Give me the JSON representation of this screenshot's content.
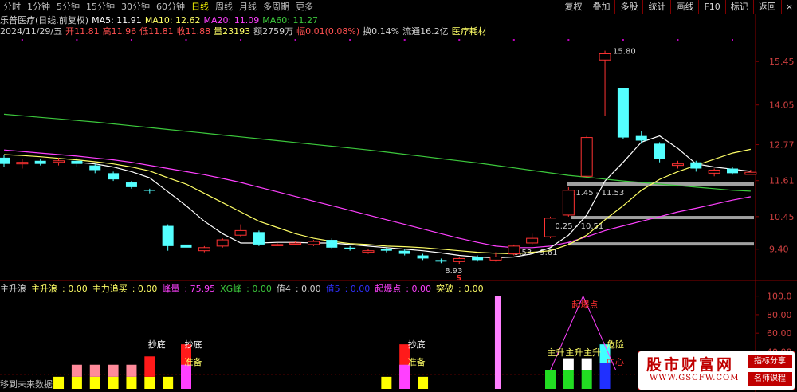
{
  "toolbar": {
    "periods": [
      "分时",
      "1分钟",
      "5分钟",
      "15分钟",
      "30分钟",
      "60分钟",
      "日线",
      "周线",
      "月线",
      "多周期",
      "更多"
    ],
    "active_period": "日线",
    "tools": [
      "复权",
      "叠加",
      "多股",
      "统计",
      "画线",
      "F10",
      "标记",
      "返回"
    ],
    "close_glyph": "×"
  },
  "title": {
    "name": "乐普医疗(日线,前复权)",
    "ma5": "MA5: 11.91",
    "ma10": "MA10: 12.62",
    "ma20": "MA20: 11.09",
    "ma60": "MA60: 11.27"
  },
  "info": {
    "date": "2024/11/29/五",
    "open": "开11.81",
    "high": "高11.96",
    "low": "低11.81",
    "close": "收11.88",
    "volume": "量23193",
    "amount": "额2759万",
    "change": "幅0.01(0.08%)",
    "turnover": "换0.14%",
    "float": "流通16.2亿",
    "sector": "医疗耗材"
  },
  "colors": {
    "up": "#ff3232",
    "down": "#54ffff",
    "ma5": "#ffffff",
    "ma10": "#ffff66",
    "ma20": "#ff40ff",
    "ma60": "#3cc83c",
    "axis": "#880000",
    "hbar": "#a0a0a0"
  },
  "price_axis": {
    "labels": [
      "15.45",
      "14.05",
      "12.77",
      "11.61",
      "10.45",
      "9.40"
    ],
    "values": [
      15.45,
      14.05,
      12.77,
      11.61,
      10.45,
      9.4
    ]
  },
  "indicator_axis": {
    "labels": [
      "100.0",
      "80.00",
      "60.00",
      "40.00",
      "20.00"
    ],
    "values": [
      100,
      80,
      60,
      40,
      20
    ]
  },
  "chart_data": {
    "type": "candlestick",
    "price_range": [
      8.7,
      16.2
    ],
    "candles": [
      {
        "o": 12.35,
        "c": 12.15,
        "h": 12.45,
        "l": 12.05
      },
      {
        "o": 12.15,
        "c": 12.2,
        "h": 12.3,
        "l": 12.0
      },
      {
        "o": 12.25,
        "c": 12.15,
        "h": 12.3,
        "l": 12.1
      },
      {
        "o": 12.2,
        "c": 12.25,
        "h": 12.35,
        "l": 12.1
      },
      {
        "o": 12.25,
        "c": 12.15,
        "h": 12.35,
        "l": 12.05
      },
      {
        "o": 12.1,
        "c": 11.95,
        "h": 12.15,
        "l": 11.85
      },
      {
        "o": 11.85,
        "c": 11.65,
        "h": 11.9,
        "l": 11.6
      },
      {
        "o": 11.55,
        "c": 11.4,
        "h": 11.6,
        "l": 11.35
      },
      {
        "o": 11.32,
        "c": 11.3,
        "h": 11.35,
        "l": 11.2
      },
      {
        "o": 10.15,
        "c": 9.5,
        "h": 10.2,
        "l": 9.35
      },
      {
        "o": 9.55,
        "c": 9.45,
        "h": 9.6,
        "l": 9.35
      },
      {
        "o": 9.35,
        "c": 9.45,
        "h": 9.5,
        "l": 9.3
      },
      {
        "o": 9.5,
        "c": 9.7,
        "h": 9.75,
        "l": 9.45
      },
      {
        "o": 9.85,
        "c": 10.0,
        "h": 10.2,
        "l": 9.8
      },
      {
        "o": 9.95,
        "c": 9.55,
        "h": 10.0,
        "l": 9.5
      },
      {
        "o": 9.55,
        "c": 9.55,
        "h": 9.6,
        "l": 9.5
      },
      {
        "o": 9.6,
        "c": 9.6,
        "h": 9.65,
        "l": 9.55
      },
      {
        "o": 9.55,
        "c": 9.65,
        "h": 9.7,
        "l": 9.5
      },
      {
        "o": 9.7,
        "c": 9.45,
        "h": 9.75,
        "l": 9.4
      },
      {
        "o": 9.45,
        "c": 9.4,
        "h": 9.5,
        "l": 9.35
      },
      {
        "o": 9.3,
        "c": 9.35,
        "h": 9.4,
        "l": 9.25
      },
      {
        "o": 9.4,
        "c": 9.35,
        "h": 9.45,
        "l": 9.3
      },
      {
        "o": 9.35,
        "c": 9.25,
        "h": 9.4,
        "l": 9.2
      },
      {
        "o": 9.2,
        "c": 9.1,
        "h": 9.25,
        "l": 9.05
      },
      {
        "o": 9.05,
        "c": 9.0,
        "h": 9.1,
        "l": 8.95
      },
      {
        "o": 9.0,
        "c": 9.1,
        "h": 9.15,
        "l": 8.93
      },
      {
        "o": 9.15,
        "c": 9.05,
        "h": 9.2,
        "l": 9.0
      },
      {
        "o": 9.05,
        "c": 9.15,
        "h": 9.3,
        "l": 9.0
      },
      {
        "o": 9.25,
        "c": 9.5,
        "h": 9.55,
        "l": 9.2
      },
      {
        "o": 9.6,
        "c": 9.75,
        "h": 9.9,
        "l": 9.55
      },
      {
        "o": 9.8,
        "c": 10.4,
        "h": 10.45,
        "l": 9.75
      },
      {
        "o": 10.5,
        "c": 11.3,
        "h": 11.4,
        "l": 10.45
      },
      {
        "o": 11.75,
        "c": 13.0,
        "h": 13.05,
        "l": 11.7
      },
      {
        "o": 15.5,
        "c": 15.7,
        "h": 15.8,
        "l": 13.7
      },
      {
        "o": 14.6,
        "c": 13.0,
        "h": 14.6,
        "l": 12.95
      },
      {
        "o": 13.05,
        "c": 12.9,
        "h": 13.2,
        "l": 12.8
      },
      {
        "o": 12.8,
        "c": 12.3,
        "h": 12.85,
        "l": 12.2
      },
      {
        "o": 12.1,
        "c": 12.15,
        "h": 12.25,
        "l": 12.0
      },
      {
        "o": 12.2,
        "c": 12.0,
        "h": 12.25,
        "l": 11.9
      },
      {
        "o": 11.85,
        "c": 11.95,
        "h": 12.0,
        "l": 11.75
      },
      {
        "o": 12.0,
        "c": 11.85,
        "h": 12.05,
        "l": 11.8
      },
      {
        "o": 11.81,
        "c": 11.88,
        "h": 11.96,
        "l": 11.81
      }
    ],
    "ma5": [
      null,
      null,
      null,
      null,
      12.2,
      12.15,
      12.05,
      11.9,
      11.7,
      11.25,
      10.8,
      10.3,
      9.9,
      9.6,
      9.6,
      9.62,
      9.62,
      9.6,
      9.6,
      9.55,
      9.5,
      9.45,
      9.4,
      9.35,
      9.28,
      9.2,
      9.15,
      9.12,
      9.15,
      9.25,
      9.45,
      9.85,
      10.5,
      11.6,
      12.2,
      12.85,
      13.05,
      12.65,
      12.15,
      12.05,
      11.98,
      11.91
    ],
    "ma10": [
      12.45,
      12.42,
      12.38,
      12.33,
      12.28,
      12.22,
      12.15,
      12.05,
      11.92,
      11.7,
      11.5,
      11.2,
      10.9,
      10.6,
      10.3,
      10.1,
      9.9,
      9.75,
      9.65,
      9.58,
      9.55,
      9.5,
      9.48,
      9.45,
      9.4,
      9.35,
      9.3,
      9.27,
      9.25,
      9.3,
      9.35,
      9.55,
      9.85,
      10.35,
      10.8,
      11.3,
      11.65,
      11.9,
      12.1,
      12.3,
      12.5,
      12.62
    ],
    "ma20": [
      12.6,
      12.55,
      12.5,
      12.45,
      12.4,
      12.34,
      12.28,
      12.2,
      12.1,
      12.0,
      11.9,
      11.8,
      11.68,
      11.55,
      11.4,
      11.25,
      11.1,
      10.95,
      10.8,
      10.65,
      10.5,
      10.35,
      10.2,
      10.05,
      9.9,
      9.75,
      9.62,
      9.5,
      9.45,
      9.45,
      9.5,
      9.62,
      9.8,
      10.0,
      10.15,
      10.3,
      10.45,
      10.6,
      10.72,
      10.85,
      10.98,
      11.09
    ],
    "ma60": [
      13.75,
      13.7,
      13.65,
      13.6,
      13.55,
      13.5,
      13.44,
      13.38,
      13.32,
      13.26,
      13.2,
      13.14,
      13.08,
      13.02,
      12.96,
      12.9,
      12.84,
      12.78,
      12.72,
      12.66,
      12.6,
      12.53,
      12.46,
      12.39,
      12.32,
      12.25,
      12.18,
      12.1,
      12.02,
      11.94,
      11.86,
      11.78,
      11.72,
      11.66,
      11.6,
      11.55,
      11.5,
      11.45,
      11.4,
      11.35,
      11.3,
      11.27
    ],
    "price_annotations": {
      "high_label": "15.80",
      "low_label": "8.93",
      "s_marker": "S",
      "band1": "11.45 - 11.53",
      "band2": "10.25 - 10.51",
      "band3": "9.53 - 9.61"
    },
    "indicator_series": [
      {
        "name": "主升浪"
      },
      {
        "name": "主力追买"
      },
      {
        "name": "峰量"
      },
      {
        "name": "XG峰"
      },
      {
        "name": "值4"
      },
      {
        "name": "值5"
      },
      {
        "name": "起爆点"
      },
      {
        "name": "突破"
      }
    ],
    "indicator_range": [
      0,
      110
    ],
    "bars_yellow": [
      0,
      0,
      0,
      13,
      13,
      13,
      13,
      13,
      13,
      13,
      13,
      0,
      0,
      0,
      0,
      0,
      0,
      0,
      0,
      0,
      0,
      13,
      13,
      13,
      0,
      0,
      0,
      0,
      0,
      0,
      0,
      0,
      0,
      0,
      0,
      0,
      0,
      0,
      0,
      0,
      0,
      0
    ],
    "bars_pink": [
      0,
      0,
      0,
      0,
      13,
      13,
      13,
      13,
      0,
      0,
      13,
      0,
      0,
      0,
      0,
      0,
      0,
      0,
      0,
      0,
      0,
      0,
      13,
      0,
      0,
      0,
      0,
      0,
      0,
      0,
      0,
      0,
      0,
      0,
      0,
      0,
      0,
      0,
      0,
      0,
      0,
      0
    ],
    "bars_red": [
      0,
      0,
      0,
      0,
      0,
      0,
      0,
      0,
      22,
      0,
      22,
      0,
      0,
      0,
      0,
      0,
      0,
      0,
      0,
      0,
      0,
      0,
      22,
      0,
      0,
      0,
      0,
      0,
      0,
      0,
      0,
      0,
      0,
      0,
      0,
      0,
      0,
      0,
      0,
      0,
      0,
      0
    ],
    "tall_bar_value": 100,
    "labels": {
      "chaodi": "抄底",
      "zhunbei": "准备",
      "zhusheng": "主升",
      "qibao": "起爆点",
      "weixian": "危险",
      "zhongxin": "中心"
    }
  },
  "footer": {
    "future_note": "移到未来数据"
  },
  "watermark": {
    "main": "股市财富网",
    "url": "WWW.GSCFW.COM",
    "tag1": "指标分享",
    "tag2": "名师课程"
  }
}
